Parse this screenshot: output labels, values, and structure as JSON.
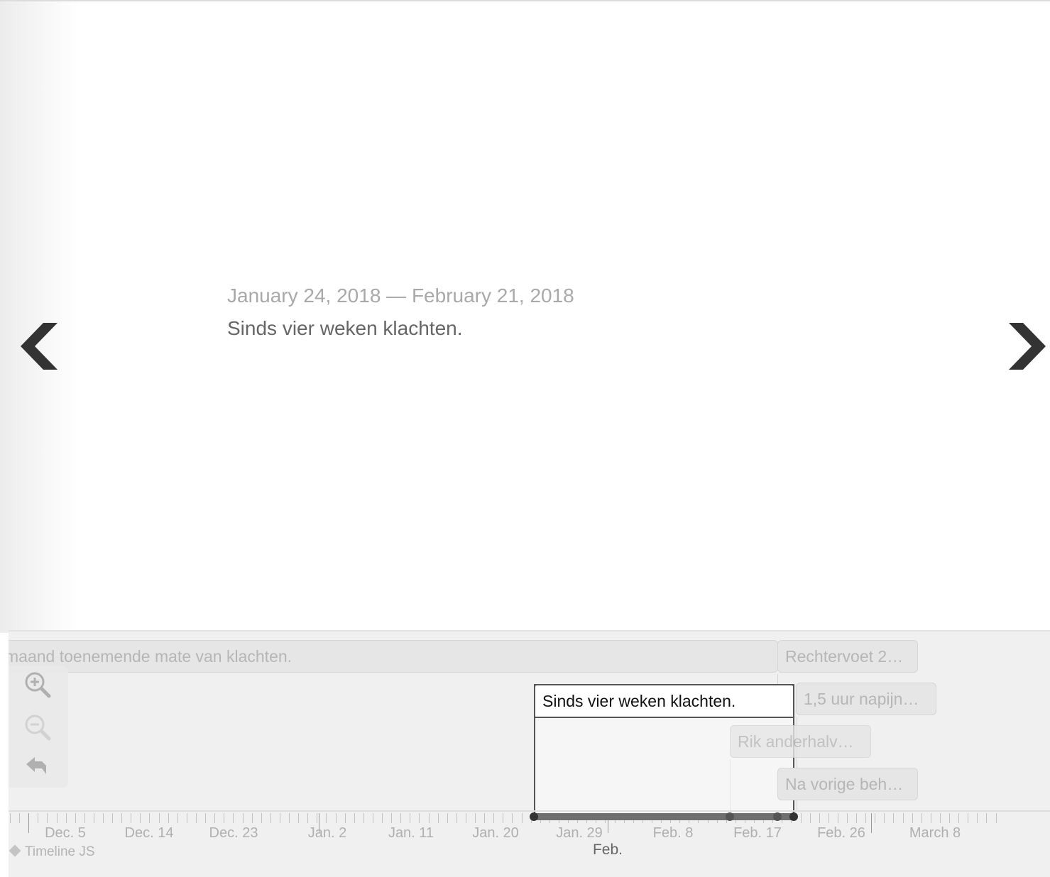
{
  "slide": {
    "date_range": "January 24, 2018 — February 21, 2018",
    "text": "Sinds vier weken klachten.",
    "prev_icon": "chevron-left-icon",
    "next_icon": "chevron-right-icon"
  },
  "timeline": {
    "markers": [
      {
        "label": "maand toenemende mate van klachten."
      },
      {
        "label": "Rechtervoet 2…"
      },
      {
        "label": "1,5 uur napijn…"
      },
      {
        "label": "Rik anderhalv…"
      },
      {
        "label": "Na vorige beh…"
      }
    ],
    "active_marker": {
      "label": "Sinds vier weken klachten."
    },
    "zoom": {
      "zoom_in_icon": "zoom-in-icon",
      "zoom_out_icon": "zoom-out-icon",
      "back_icon": "back-arrow-icon"
    },
    "axis_labels": [
      "Dec. 5",
      "Dec. 14",
      "Dec. 23",
      "Jan. 2",
      "Jan. 11",
      "Jan. 20",
      "Jan. 29",
      "Feb. 8",
      "Feb. 17",
      "Feb. 26",
      "March 8"
    ],
    "axis_major_label": "Feb."
  },
  "credit": {
    "text": "Timeline JS"
  },
  "colors": {
    "accent": "#333333",
    "nav_background": "#f0f0f0"
  }
}
